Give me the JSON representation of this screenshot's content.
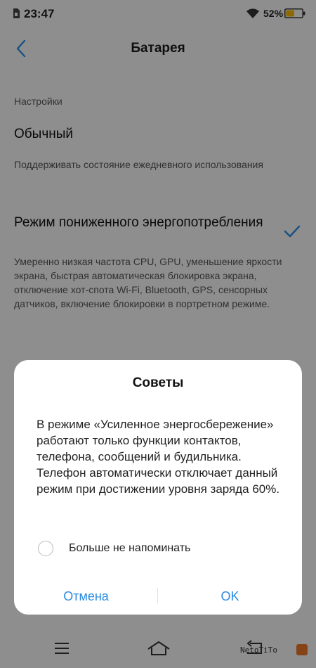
{
  "status_bar": {
    "time": "23:47",
    "battery_percent": "52%",
    "battery_level": 0.52
  },
  "header": {
    "title": "Батарея"
  },
  "settings": {
    "section_label": "Настройки",
    "option_normal": {
      "title": "Обычный",
      "description": "Поддерживать состояние ежедневного использования"
    },
    "option_low_power": {
      "title": "Режим пониженного энергопотребления",
      "description": "Умеренно низкая частота CPU, GPU, уменьшение яркости экрана, быстрая автоматическая блокировка экрана, отключение хот-спота Wi-Fi, Bluetooth, GPS, сенсорных датчиков, включение блокировки в портретном режиме.",
      "selected": true
    }
  },
  "dialog": {
    "title": "Советы",
    "message": "В режиме «Усиленное энергосбережение» работают только функции контактов, телефона, сообщений и будильника. Телефон автоматически отключает данный режим при достижении уровня заряда 60%.",
    "checkbox_label": "Больше не напоминать",
    "checkbox_checked": false,
    "cancel_label": "Отмена",
    "ok_label": "OK"
  },
  "colors": {
    "accent": "#2b8ae0",
    "battery_fill": "#f5b400"
  }
}
